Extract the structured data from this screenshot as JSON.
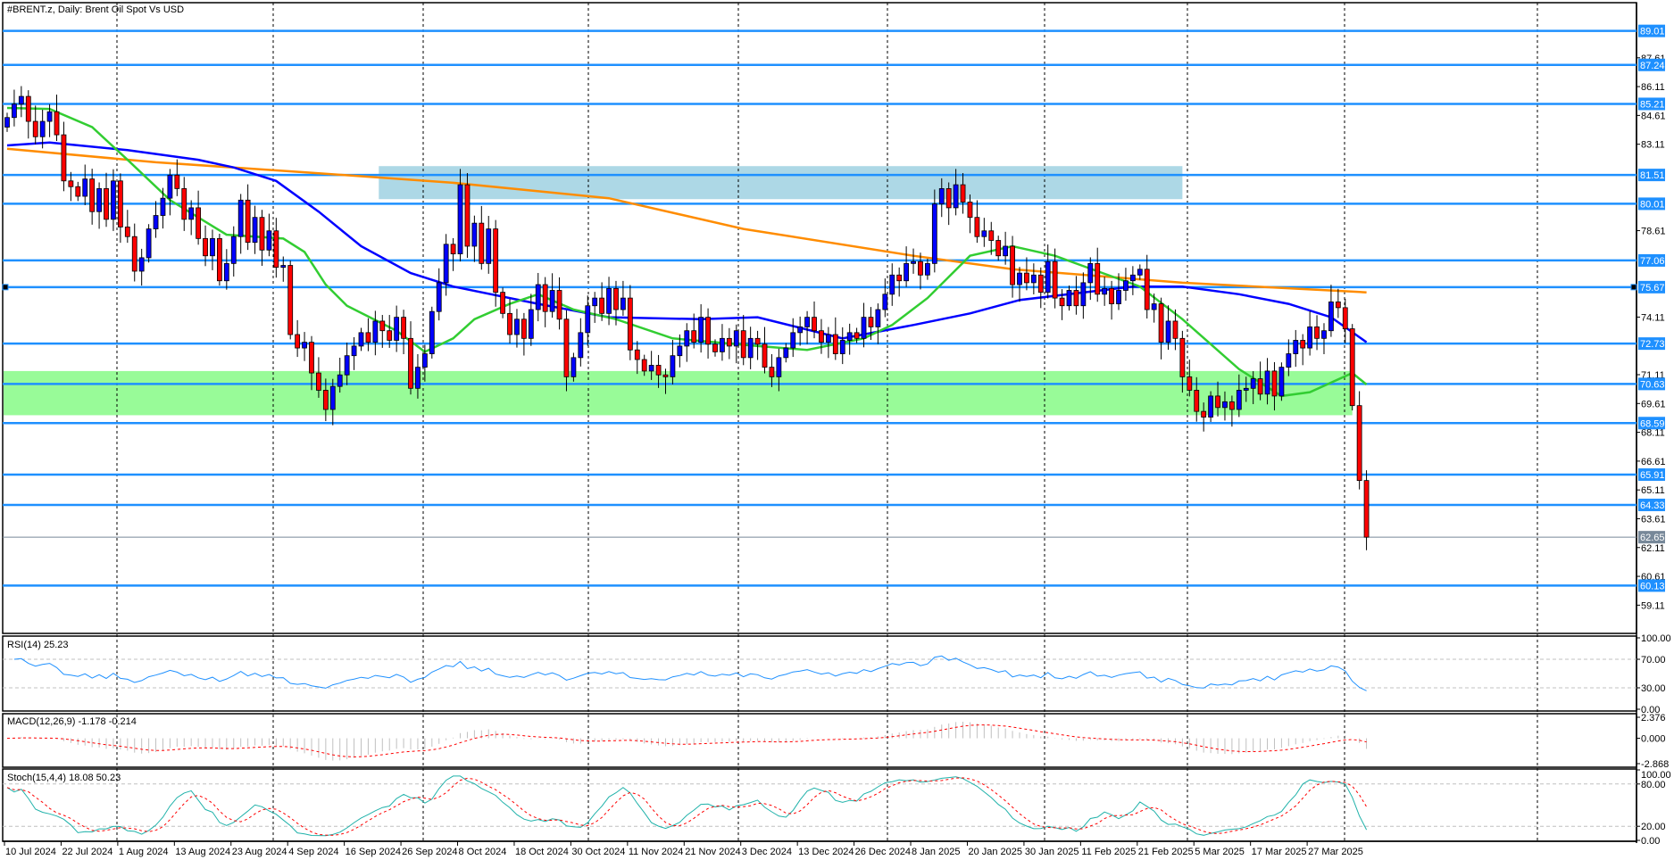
{
  "window_title": "#BRENT.z, Daily:  Brent Oil Spot Vs USD",
  "colors": {
    "up_candle": "#0000ff",
    "down_candle": "#ff0000",
    "level_line": "#1e90ff",
    "current_price": "#778899",
    "ma_fast": "#32cd32",
    "ma_medium": "#0000ff",
    "ma_slow": "#ff8c00",
    "rsi": "#1e90ff",
    "macd_hist": "#c0c0c0",
    "macd_signal": "#ff0000",
    "stoch_main": "#20b2aa",
    "stoch_signal": "#ff0000"
  },
  "chart_data": {
    "type": "candlestick",
    "title": "#BRENT.z, Daily:  Brent Oil Spot Vs USD",
    "ylim": [
      57.64,
      90.48
    ],
    "price_ticks": [
      "87.61",
      "86.11",
      "84.61",
      "83.11",
      "78.61",
      "74.11",
      "71.11",
      "69.61",
      "68.11",
      "66.61",
      "65.11",
      "63.61",
      "62.11",
      "60.61",
      "59.11"
    ],
    "levels": [
      "89.01",
      "87.24",
      "85.21",
      "81.51",
      "80.01",
      "77.06",
      "75.67",
      "72.73",
      "70.63",
      "68.59",
      "65.91",
      "64.33",
      "60.13"
    ],
    "current_price": "62.65",
    "first_open": 84.0,
    "closes": [
      84.5,
      85.2,
      85.6,
      84.3,
      83.5,
      84.3,
      84.8,
      83.6,
      81.2,
      80.9,
      80.4,
      81.3,
      79.6,
      80.8,
      79.2,
      81.2,
      78.8,
      78.3,
      76.5,
      77.2,
      78.7,
      79.4,
      80.3,
      81.5,
      80.8,
      79.2,
      79.8,
      78.2,
      77.3,
      78.2,
      76.0,
      76.9,
      78.3,
      80.2,
      78.0,
      79.3,
      77.6,
      78.6,
      76.7,
      76.8,
      73.2,
      72.5,
      72.8,
      71.2,
      70.3,
      69.3,
      70.5,
      71.1,
      72.1,
      72.6,
      73.3,
      72.8,
      73.9,
      73.4,
      72.9,
      74.1,
      73.0,
      70.4,
      71.5,
      72.2,
      74.4,
      75.9,
      77.9,
      77.4,
      81.0,
      77.8,
      79.0,
      76.9,
      78.7,
      75.4,
      74.3,
      73.2,
      74.0,
      73.0,
      74.5,
      75.8,
      74.4,
      75.5,
      74.0,
      71.0,
      72.0,
      73.3,
      74.7,
      75.1,
      74.3,
      75.6,
      74.5,
      75.1,
      72.4,
      71.9,
      71.3,
      71.6,
      71.1,
      71.0,
      72.1,
      72.6,
      73.4,
      72.8,
      74.1,
      72.7,
      72.3,
      73.0,
      72.6,
      73.4,
      72.0,
      73.0,
      72.7,
      71.5,
      71.0,
      72.0,
      72.5,
      73.3,
      73.6,
      74.1,
      73.4,
      72.8,
      73.2,
      72.2,
      72.9,
      73.3,
      73.0,
      74.1,
      73.6,
      74.5,
      75.3,
      76.3,
      76.0,
      76.9,
      77.0,
      76.3,
      76.9,
      80.0,
      80.8,
      79.8,
      81.0,
      80.1,
      79.3,
      78.3,
      78.6,
      78.1,
      77.3,
      77.8,
      75.8,
      76.4,
      75.9,
      76.3,
      75.4,
      77.0,
      75.1,
      74.7,
      75.5,
      74.7,
      75.9,
      76.9,
      75.3,
      75.6,
      74.8,
      75.5,
      76.0,
      76.3,
      76.6,
      74.5,
      74.8,
      72.8,
      73.9,
      73.0,
      71.0,
      70.3,
      69.2,
      68.9,
      70.0,
      69.4,
      69.7,
      69.3,
      70.3,
      70.4,
      70.9,
      70.1,
      71.3,
      70.0,
      71.5,
      72.2,
      72.9,
      72.5,
      73.6,
      73.0,
      73.4,
      74.9,
      74.6,
      73.5,
      69.5,
      65.6,
      62.65
    ],
    "moving_averages": {
      "fast": [
        [
          0,
          85.0
        ],
        [
          6,
          84.95
        ],
        [
          12,
          84.0
        ],
        [
          17,
          82.3
        ],
        [
          23,
          80.2
        ],
        [
          31,
          78.4
        ],
        [
          39,
          78.2
        ],
        [
          42,
          77.5
        ],
        [
          45,
          75.8
        ],
        [
          48,
          74.7
        ],
        [
          55,
          73.4
        ],
        [
          59,
          72.3
        ],
        [
          63,
          73.0
        ],
        [
          66,
          74.0
        ],
        [
          71,
          74.8
        ],
        [
          75,
          75.3
        ],
        [
          80,
          74.5
        ],
        [
          86,
          74.0
        ],
        [
          94,
          73.0
        ],
        [
          106,
          72.6
        ],
        [
          113,
          72.4
        ],
        [
          121,
          73.0
        ],
        [
          125,
          73.7
        ],
        [
          130,
          75.1
        ],
        [
          136,
          77.3
        ],
        [
          142,
          77.8
        ],
        [
          148,
          77.3
        ],
        [
          154,
          76.5
        ],
        [
          160,
          75.7
        ],
        [
          166,
          74.0
        ],
        [
          174,
          71.4
        ],
        [
          180,
          70.0
        ],
        [
          184,
          70.2
        ],
        [
          190,
          71.2
        ],
        [
          192,
          70.6
        ]
      ],
      "medium": [
        [
          0,
          83.05
        ],
        [
          6,
          83.2
        ],
        [
          17,
          82.8
        ],
        [
          27,
          82.3
        ],
        [
          32,
          81.9
        ],
        [
          38,
          81.2
        ],
        [
          44,
          79.6
        ],
        [
          50,
          77.8
        ],
        [
          57,
          76.4
        ],
        [
          63,
          75.7
        ],
        [
          75,
          74.8
        ],
        [
          85,
          74.1
        ],
        [
          98,
          74.0
        ],
        [
          106,
          74.1
        ],
        [
          118,
          73.0
        ],
        [
          128,
          73.7
        ],
        [
          136,
          74.3
        ],
        [
          143,
          75.0
        ],
        [
          159,
          75.7
        ],
        [
          166,
          75.7
        ],
        [
          174,
          75.3
        ],
        [
          181,
          74.8
        ],
        [
          187,
          74.1
        ],
        [
          192,
          72.8
        ]
      ],
      "slow": [
        [
          0,
          82.87
        ],
        [
          21,
          82.17
        ],
        [
          42,
          81.65
        ],
        [
          63,
          81.1
        ],
        [
          85,
          80.3
        ],
        [
          104,
          78.7
        ],
        [
          128,
          77.3
        ],
        [
          142,
          76.6
        ],
        [
          166,
          75.9
        ],
        [
          192,
          75.4
        ]
      ]
    },
    "zones": [
      {
        "from_bar": 53,
        "to_bar": 166,
        "low": 80.25,
        "high": 81.97,
        "color": "#add8e6"
      },
      {
        "from_bar": 0,
        "to_bar": 190,
        "low": 69.0,
        "high": 71.3,
        "color": "#98fb98"
      }
    ],
    "x_labels": [
      "10 Jul 2024",
      "22 Jul 2024",
      "1 Aug 2024",
      "13 Aug 2024",
      "23 Aug 2024",
      "4 Sep 2024",
      "16 Sep 2024",
      "26 Sep 2024",
      "8 Oct 2024",
      "18 Oct 2024",
      "30 Oct 2024",
      "11 Nov 2024",
      "21 Nov 2024",
      "3 Dec 2024",
      "13 Dec 2024",
      "26 Dec 2024",
      "8 Jan 2025",
      "20 Jan 2025",
      "30 Jan 2025",
      "11 Feb 2025",
      "21 Feb 2025",
      "5 Mar 2025",
      "17 Mar 2025",
      "27 Mar 2025"
    ],
    "x_label_step_bars": 8,
    "indicators": {
      "rsi": {
        "label": "RSI(14) 25.23",
        "ticks": [
          "100.00",
          "70.00",
          "30.00",
          "0.00"
        ],
        "levels": [
          70,
          30
        ],
        "range": [
          0,
          100
        ]
      },
      "macd": {
        "label": "MACD(12,26,9) -1.178 -0.214",
        "ticks": [
          "2.376",
          "0.000",
          "-2.868"
        ],
        "range": [
          -2.868,
          2.376
        ]
      },
      "stoch": {
        "label": "Stoch(15,4,4) 18.08 50.23",
        "ticks": [
          "100.00",
          "80.00",
          "20.00",
          "0.00"
        ],
        "levels": [
          80,
          20
        ],
        "range": [
          0,
          100
        ]
      }
    }
  }
}
